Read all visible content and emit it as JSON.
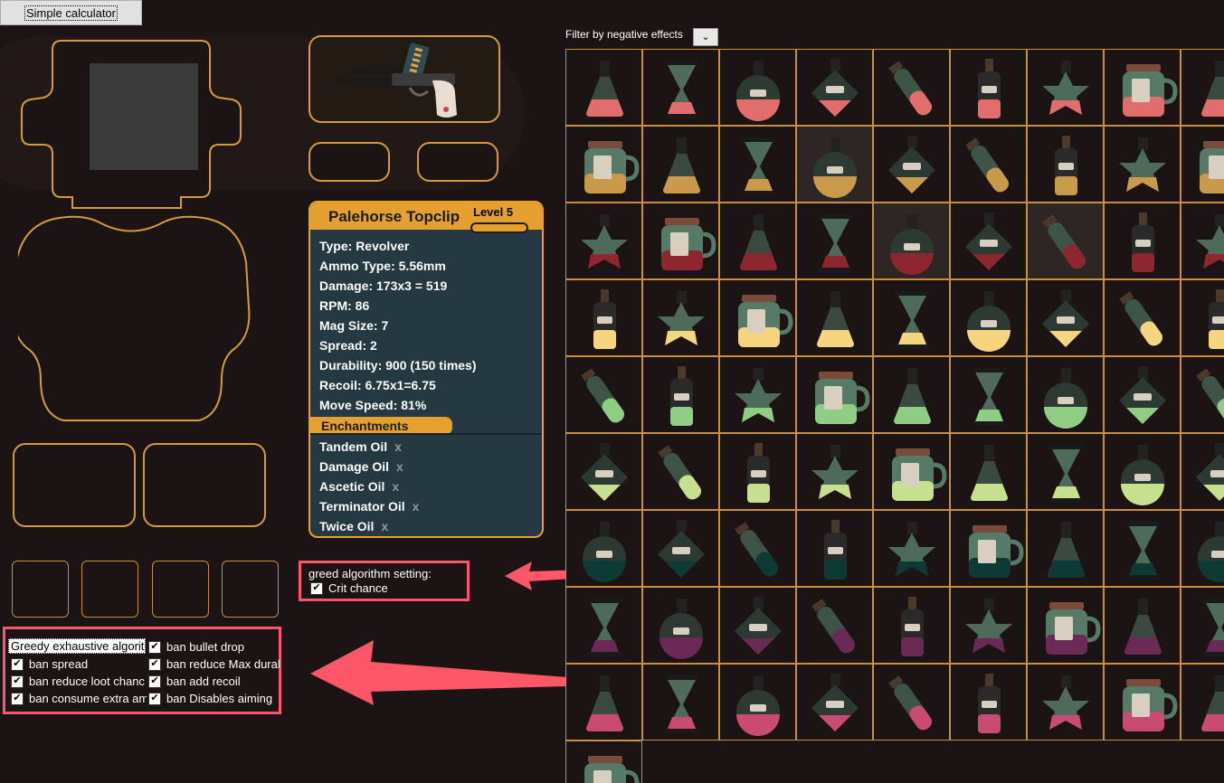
{
  "app": {
    "simple_button": "Simple calculator"
  },
  "weapon": {
    "name": "Palehorse Topclip",
    "level": "Level 5",
    "stats": [
      "Type:  Revolver",
      "Ammo Type:  5.56mm",
      "Damage:  173x3 = 519",
      "RPM:  86",
      "Mag Size:  7",
      "Spread:  2",
      "Durability:  900  (150 times)",
      "Recoil:  6.75x1=6.75",
      "Move Speed:  81%"
    ],
    "enchant_header": "Enchantments",
    "enchantments": [
      "Tandem Oil",
      "Damage Oil",
      "Ascetic Oil",
      "Terminator Oil",
      "Twice Oil"
    ],
    "remove_mark": "x"
  },
  "greed": {
    "title": "greed algorithm setting:",
    "crit_label": "Crit chance"
  },
  "bans": {
    "algo_button": "Greedy exhaustive algorit",
    "left": [
      "ban spread",
      "ban reduce loot chanc",
      "ban consume extra am"
    ],
    "right": [
      "ban bullet drop",
      "ban reduce Max durab",
      "ban add recoil",
      "ban Disables aiming"
    ]
  },
  "filter": {
    "label": "Filter by negative effects",
    "arrow": "⌄"
  },
  "colors": {
    "accent": "#e6a02f",
    "slot_border": "#d59a3f",
    "card_bg": "#253942",
    "background": "#1c1414",
    "highlight_red": "#ff5668"
  },
  "potion_liquids": [
    "#e16d6d",
    "#c89a4a",
    "#8e2630",
    "#f6d580",
    "#8fcd85",
    "#c6e08f",
    "#0e3a35",
    "#6a2a55",
    "#c94a72"
  ]
}
